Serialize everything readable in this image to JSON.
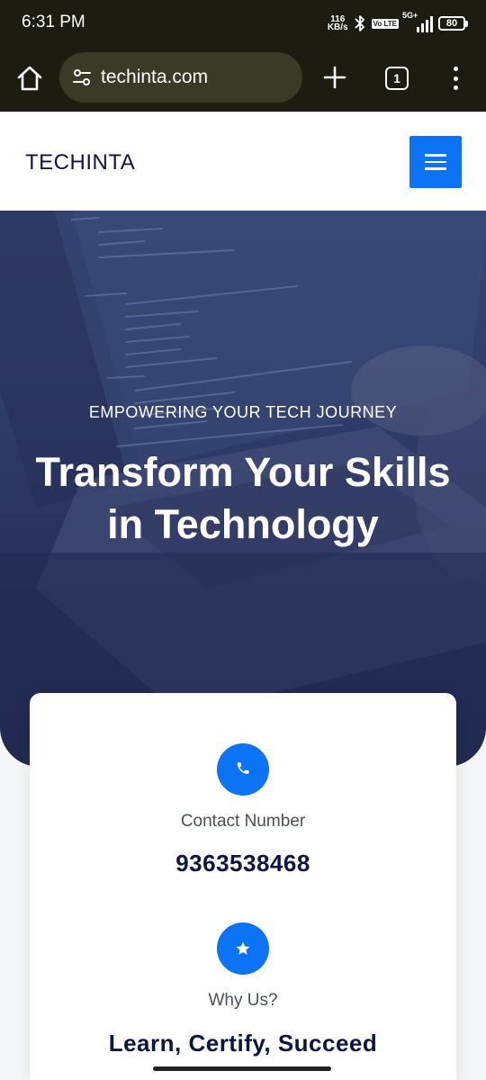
{
  "status_bar": {
    "time": "6:31 PM",
    "speed_value": "116",
    "speed_unit": "KB/s",
    "volte": "Vo LTE",
    "network": "5G+",
    "battery": "80",
    "icons": [
      "bluetooth-icon",
      "signal-icon",
      "battery-icon"
    ]
  },
  "browser": {
    "url": "techinta.com",
    "tab_count": "1",
    "icons": [
      "home-icon",
      "site-settings-icon",
      "new-tab-icon",
      "tab-switcher-icon",
      "more-menu-icon"
    ]
  },
  "header": {
    "logo": "TECHINTA",
    "menu_icon": "hamburger-icon"
  },
  "hero": {
    "kicker": "EMPOWERING YOUR TECH JOURNEY",
    "title_line1": "Transform Your Skills",
    "title_line2": "in Technology"
  },
  "info_card": {
    "items": [
      {
        "icon": "phone-icon",
        "label": "Contact Number",
        "value": "9363538468"
      },
      {
        "icon": "star-icon",
        "label": "Why Us?",
        "value": "Learn, Certify, Succeed"
      }
    ]
  },
  "colors": {
    "accent": "#0b73f4",
    "navy": "#0c1642",
    "browser_bg": "#1c1c10",
    "hero_overlay": "#2f3a66"
  }
}
